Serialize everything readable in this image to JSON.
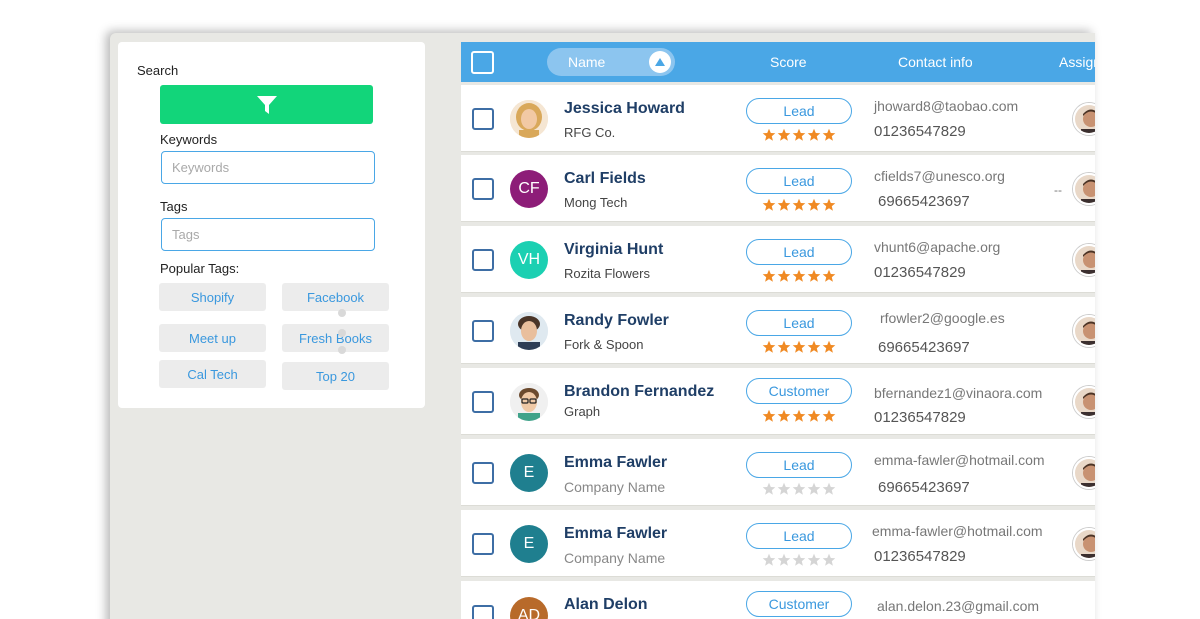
{
  "sidebar": {
    "search_title": "Search",
    "filter_icon": "filter-icon",
    "keywords_label": "Keywords",
    "keywords_placeholder": "Keywords",
    "tags_label": "Tags",
    "tags_placeholder": "Tags",
    "popular_tags_label": "Popular Tags:",
    "popular_tags": [
      "Shopify",
      "Facebook",
      "Meet up",
      "Fresh Books",
      "Cal Tech",
      "Top 20"
    ]
  },
  "table": {
    "columns": {
      "name": "Name",
      "score": "Score",
      "contact": "Contact info",
      "assigned": "Assigned"
    },
    "sort_icon": "sort-up-icon",
    "rows": [
      {
        "name": "Jessica Howard",
        "company": "RFG Co.",
        "status": "Lead",
        "stars": 5,
        "email": "jhoward8@taobao.com",
        "phone": "01236547829",
        "avatar": "photo-woman-blonde"
      },
      {
        "name": "Carl Fields",
        "company": "Mong Tech",
        "status": "Lead",
        "stars": 5,
        "email": "cfields7@unesco.org",
        "phone": "69665423697",
        "avatar_initials": "CF",
        "extra": "--"
      },
      {
        "name": "Virginia Hunt",
        "company": "Rozita Flowers",
        "status": "Lead",
        "stars": 5,
        "email": "vhunt6@apache.org",
        "phone": "01236547829",
        "avatar_initials": "VH"
      },
      {
        "name": "Randy Fowler",
        "company": "Fork & Spoon",
        "status": "Lead",
        "stars": 5,
        "email": "rfowler2@google.es",
        "phone": "69665423697",
        "avatar": "photo-man-dark-hair"
      },
      {
        "name": "Brandon Fernandez",
        "company": "Graph",
        "status": "Customer",
        "stars": 5,
        "email": "bfernandez1@vinaora.com",
        "phone": "01236547829",
        "avatar": "photo-man-glasses"
      },
      {
        "name": "Emma Fawler",
        "company": "Company Name",
        "status": "Lead",
        "stars": 0,
        "email": "emma-fawler@hotmail.com",
        "phone": "69665423697",
        "avatar_initials": "E"
      },
      {
        "name": "Emma Fawler",
        "company": "Company Name",
        "status": "Lead",
        "stars": 0,
        "email": "emma-fawler@hotmail.com",
        "phone": "01236547829",
        "avatar_initials": "E"
      },
      {
        "name": "Alan Delon",
        "company": "",
        "status": "Customer",
        "stars": 0,
        "email": "alan.delon.23@gmail.com",
        "phone": "",
        "avatar_initials": "AD"
      }
    ]
  },
  "colors": {
    "header_blue": "#4aa7e6",
    "filter_green": "#12d57a",
    "star_filled": "#f08a24",
    "star_empty": "#d5d5d5",
    "avatar_cf": "#8d1d78",
    "avatar_vh": "#1bd0b2",
    "avatar_e": "#1f7f8f",
    "avatar_ad": "#b86a2a"
  }
}
